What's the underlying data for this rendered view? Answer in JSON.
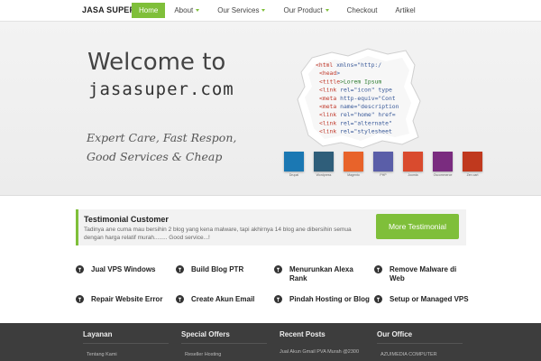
{
  "nav": {
    "logo": "JASA SUPER",
    "items": [
      {
        "label": "Home",
        "active": true,
        "caret": false
      },
      {
        "label": "About",
        "active": false,
        "caret": true
      },
      {
        "label": "Our Services",
        "active": false,
        "caret": true
      },
      {
        "label": "Our Product",
        "active": false,
        "caret": true
      },
      {
        "label": "Checkout",
        "active": false,
        "caret": false
      },
      {
        "label": "Artikel",
        "active": false,
        "caret": false
      }
    ]
  },
  "hero": {
    "title": "Welcome to",
    "site": "jasasuper.com",
    "slogan_line1": "Expert Care, Fast Respon,",
    "slogan_line2": "Good Services & Cheap",
    "code_lines": [
      "<html xmlns=\"http:/",
      "<head>",
      "<title>Lorem Ipsum",
      "<link rel=\"icon\" type",
      "<meta http-equiv=\"Cont",
      "<meta name=\"description",
      "<link rel=\"home\" href=",
      "<link rel=\"alternate\"",
      "<link rel=\"stylesheet"
    ],
    "tech_icons": [
      {
        "name": "drupal-icon",
        "label": "Drupal",
        "color": "#1b78b3"
      },
      {
        "name": "wordpress-icon",
        "label": "Wordpress",
        "color": "#2f5e7a"
      },
      {
        "name": "magento-icon",
        "label": "Magento",
        "color": "#e8632a"
      },
      {
        "name": "php-icon",
        "label": "PHP",
        "color": "#5a5ea8"
      },
      {
        "name": "joomla-icon",
        "label": "Joomla",
        "color": "#d94b2e"
      },
      {
        "name": "osCommerce-icon",
        "label": "Oscommerce",
        "color": "#7a2c7f"
      },
      {
        "name": "zen-cart-icon",
        "label": "Zen cart",
        "color": "#c0391e"
      }
    ]
  },
  "testimonial": {
    "title": "Testimonial Customer",
    "text": "Tadinya ane cuma mau bersihin 2 blog yang kena malware, tapi akhirnya 14 blog ane dibersihin semua dengan harga relatif murah........ Good service...!",
    "button": "More Testimonial"
  },
  "services": [
    "Jual VPS Windows",
    "Build Blog PTR",
    "Menurunkan Alexa Rank",
    "Remove Malware di Web",
    "Repair Website Error",
    "Create Akun Email",
    "Pindah Hosting or Blog",
    "Setup or Managed VPS"
  ],
  "footer": {
    "columns": [
      {
        "title": "Layanan",
        "item": "Tentang Kami"
      },
      {
        "title": "Special Offers",
        "item": "Reseller Hosting"
      },
      {
        "title": "Recent Posts",
        "item": "Jual Akun Gmail PVA Murah @2300"
      },
      {
        "title": "Our Office",
        "item": "AZUIMEDIA COMPUTER"
      }
    ]
  },
  "colors": {
    "accent": "#7fbf3a",
    "footer_bg": "#3d3d3d"
  }
}
